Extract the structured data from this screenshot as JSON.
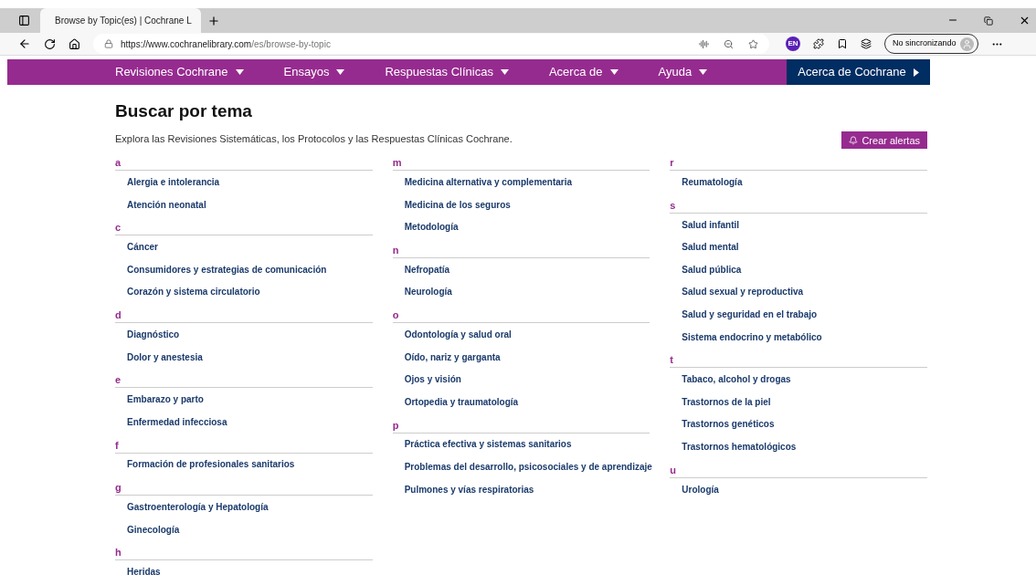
{
  "browser": {
    "tab_title": "Browse by Topic(es) | Cochrane L",
    "url_host": "https://www.cochranelibrary.com",
    "url_path": "/es/browse-by-topic",
    "profile_label": "No sincronizando",
    "extension_badge": "EN"
  },
  "nav": {
    "items": [
      {
        "label": "Revisiones Cochrane"
      },
      {
        "label": "Ensayos"
      },
      {
        "label": "Respuestas Clínicas"
      },
      {
        "label": "Acerca de"
      },
      {
        "label": "Ayuda"
      }
    ],
    "highlight": "Acerca de Cochrane"
  },
  "page": {
    "title": "Buscar por tema",
    "intro": "Explora las Revisiones Sistemáticas, los Protocolos y las Respuestas Clínicas Cochrane.",
    "alert_button": "Crear alertas"
  },
  "columns": [
    [
      {
        "letter": "a",
        "topics": [
          "Alergia e intolerancia",
          "Atención neonatal"
        ]
      },
      {
        "letter": "c",
        "topics": [
          "Cáncer",
          "Consumidores y estrategias de comunicación",
          "Corazón y sistema circulatorio"
        ]
      },
      {
        "letter": "d",
        "topics": [
          "Diagnóstico",
          "Dolor y anestesia"
        ]
      },
      {
        "letter": "e",
        "topics": [
          "Embarazo y parto",
          "Enfermedad infecciosa"
        ]
      },
      {
        "letter": "f",
        "topics": [
          "Formación de profesionales sanitarios"
        ]
      },
      {
        "letter": "g",
        "topics": [
          "Gastroenterología y Hepatología",
          "Ginecología"
        ]
      },
      {
        "letter": "h",
        "topics": [
          "Heridas"
        ]
      }
    ],
    [
      {
        "letter": "m",
        "topics": [
          "Medicina alternativa y complementaria",
          "Medicina de los seguros",
          "Metodología"
        ]
      },
      {
        "letter": "n",
        "topics": [
          "Nefropatía",
          "Neurología"
        ]
      },
      {
        "letter": "o",
        "topics": [
          "Odontología y salud oral",
          "Oído, nariz y garganta",
          "Ojos y visión",
          "Ortopedia y traumatología"
        ]
      },
      {
        "letter": "p",
        "topics": [
          "Práctica efectiva y sistemas sanitarios",
          "Problemas del desarrollo, psicosociales y de aprendizaje",
          "Pulmones y vías respiratorias"
        ]
      }
    ],
    [
      {
        "letter": "r",
        "topics": [
          "Reumatología"
        ]
      },
      {
        "letter": "s",
        "topics": [
          "Salud infantil",
          "Salud mental",
          "Salud pública",
          "Salud sexual y reproductiva",
          "Salud y seguridad en el trabajo",
          "Sistema endocrino y metabólico"
        ]
      },
      {
        "letter": "t",
        "topics": [
          "Tabaco, alcohol y drogas",
          "Trastornos de la piel",
          "Trastornos genéticos",
          "Trastornos hematológicos"
        ]
      },
      {
        "letter": "u",
        "topics": [
          "Urología"
        ]
      }
    ]
  ]
}
